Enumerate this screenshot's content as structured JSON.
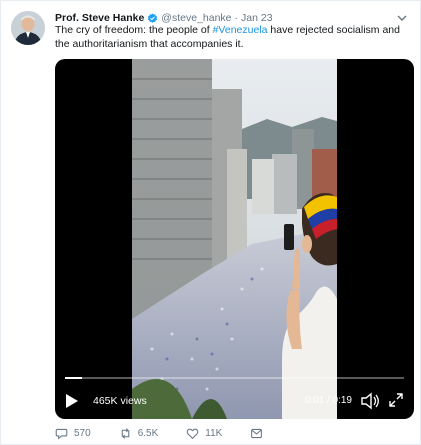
{
  "tweet": {
    "author_name": "Prof. Steve Hanke",
    "handle": "@steve_hanke",
    "separator": "·",
    "date": "Jan 23",
    "text_before": "The cry of freedom: the people of ",
    "hashtag": "#Venezuela",
    "text_after": " have rejected socialism and the authoritarianism that accompanies it."
  },
  "video": {
    "views": "465K views",
    "time": "0:01 / 0:19",
    "progress": 0.05
  },
  "actions": {
    "replies": "570",
    "retweets": "6.5K",
    "likes": "11K"
  },
  "colors": {
    "accent": "#1b95e0",
    "muted": "#657786"
  },
  "icons": [
    "verified-badge-icon",
    "caret-down-icon",
    "play-icon",
    "volume-icon",
    "fullscreen-icon",
    "reply-icon",
    "retweet-icon",
    "like-icon",
    "share-icon"
  ]
}
